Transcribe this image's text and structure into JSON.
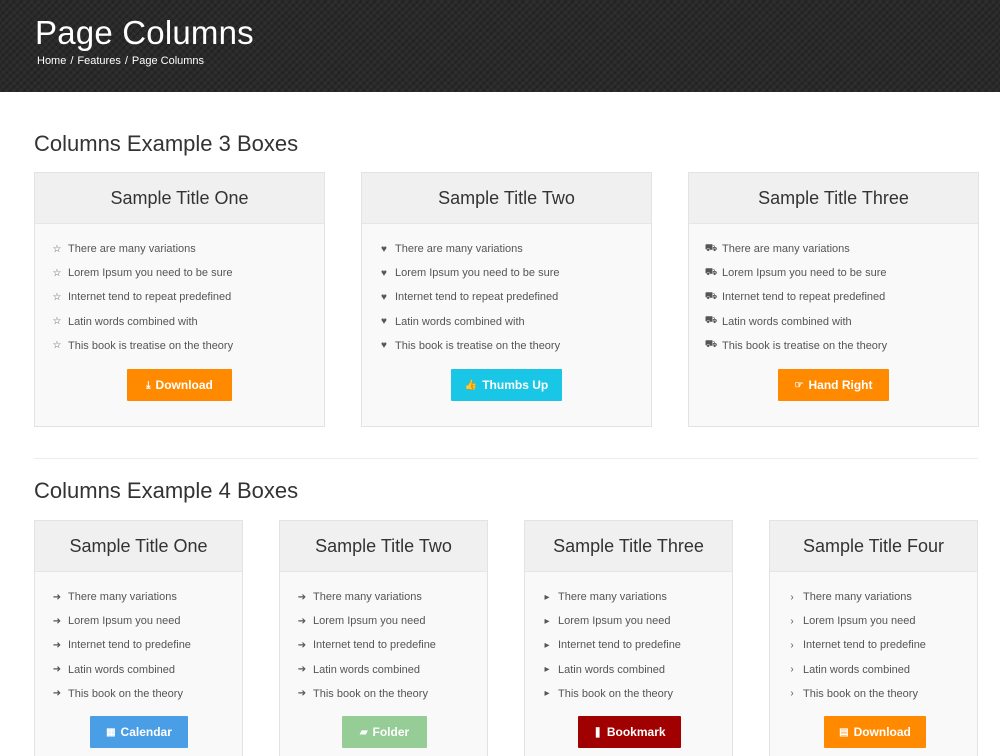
{
  "header": {
    "title": "Page Columns",
    "breadcrumb": [
      "Home",
      "Features",
      "Page Columns"
    ]
  },
  "sections": [
    {
      "title": "Columns Example 3 Boxes",
      "boxes": [
        {
          "title": "Sample Title One",
          "list_icon": "star-outline-icon",
          "items": [
            "There are many variations",
            "Lorem Ipsum you need to be sure",
            "Internet tend to repeat predefined",
            "Latin words combined with",
            "This book is treatise on the theory"
          ],
          "button": {
            "label": "Download",
            "icon": "download-icon",
            "color": "#ff8a00"
          }
        },
        {
          "title": "Sample Title Two",
          "list_icon": "heart-icon",
          "items": [
            "There are many variations",
            "Lorem Ipsum you need to be sure",
            "Internet tend to repeat predefined",
            "Latin words combined with",
            "This book is treatise on the theory"
          ],
          "button": {
            "label": "Thumbs Up",
            "icon": "thumbs-up-icon",
            "color": "#1ac6e6"
          }
        },
        {
          "title": "Sample Title Three",
          "list_icon": "cart-icon",
          "items": [
            "There are many variations",
            "Lorem Ipsum you need to be sure",
            "Internet tend to repeat predefined",
            "Latin words combined with",
            "This book is treatise on the theory"
          ],
          "button": {
            "label": "Hand Right",
            "icon": "hand-right-icon",
            "color": "#ff8a00"
          }
        }
      ]
    },
    {
      "title": "Columns Example 4 Boxes",
      "boxes": [
        {
          "title": "Sample Title One",
          "list_icon": "chevron-circle-right-icon",
          "items": [
            "There many variations",
            "Lorem Ipsum you need",
            "Internet tend to predefine",
            "Latin words combined",
            "This book on the theory"
          ],
          "button": {
            "label": "Calendar",
            "icon": "calendar-icon",
            "color": "#4a9ee6"
          }
        },
        {
          "title": "Sample Title Two",
          "list_icon": "arrow-circle-right-icon",
          "items": [
            "There many variations",
            "Lorem Ipsum you need",
            "Internet tend to predefine",
            "Latin words combined",
            "This book on the theory"
          ],
          "button": {
            "label": "Folder",
            "icon": "folder-icon",
            "color": "#96cc96"
          }
        },
        {
          "title": "Sample Title Three",
          "list_icon": "caret-right-icon",
          "items": [
            "There many variations",
            "Lorem Ipsum you need",
            "Internet tend to predefine",
            "Latin words combined",
            "This book on the theory"
          ],
          "button": {
            "label": "Bookmark",
            "icon": "bookmark-icon",
            "color": "#a00000"
          }
        },
        {
          "title": "Sample Title Four",
          "list_icon": "chevron-right-icon",
          "items": [
            "There many variations",
            "Lorem Ipsum you need",
            "Internet tend to predefine",
            "Latin words combined",
            "This book on the theory"
          ],
          "button": {
            "label": "Download",
            "icon": "file-icon",
            "color": "#ff8a00"
          }
        }
      ]
    }
  ]
}
